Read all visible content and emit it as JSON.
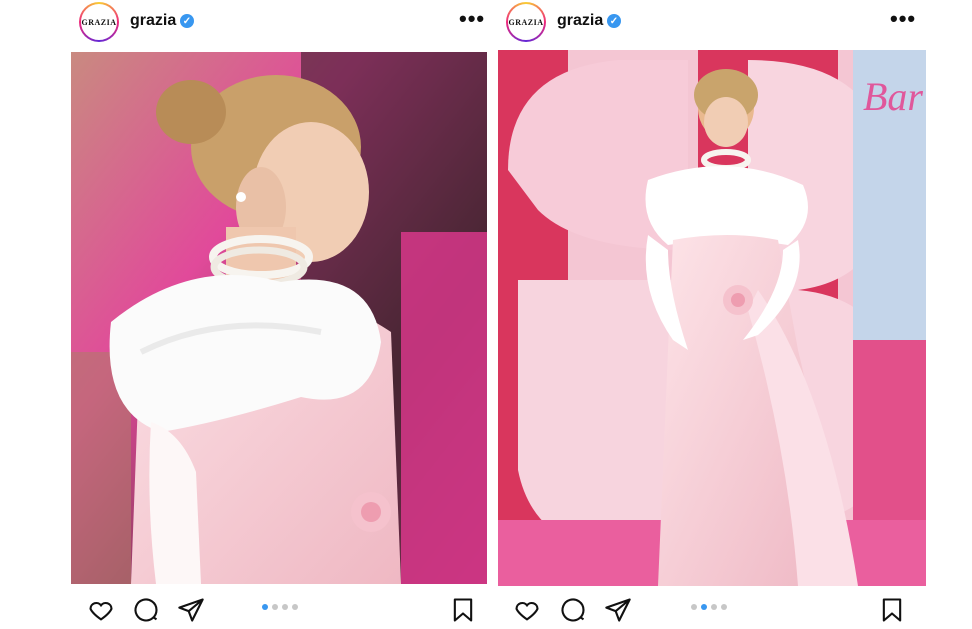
{
  "posts": [
    {
      "account": {
        "username": "grazia",
        "avatar_text": "GRAZIA",
        "verified_icon": "verified-badge-icon"
      },
      "more_icon": "more-options-icon",
      "image": {
        "description_icon": "photo"
      },
      "actions": {
        "like": "heart-icon",
        "comment": "comment-icon",
        "share": "share-icon",
        "save": "bookmark-icon"
      },
      "carousel": {
        "total": 4,
        "active_index": 0
      }
    },
    {
      "account": {
        "username": "grazia",
        "avatar_text": "GRAZIA",
        "verified_icon": "verified-badge-icon"
      },
      "more_icon": "more-options-icon",
      "image": {
        "description_icon": "photo"
      },
      "actions": {
        "like": "heart-icon",
        "comment": "comment-icon",
        "share": "share-icon",
        "save": "bookmark-icon"
      },
      "carousel": {
        "total": 4,
        "active_index": 1
      }
    }
  ],
  "ui": {
    "more_glyph": "•••",
    "verified_glyph": "✓"
  },
  "colors": {
    "accent": "#3897f0",
    "dot_inactive": "#c7c7c7",
    "pink": "#e8559b"
  }
}
